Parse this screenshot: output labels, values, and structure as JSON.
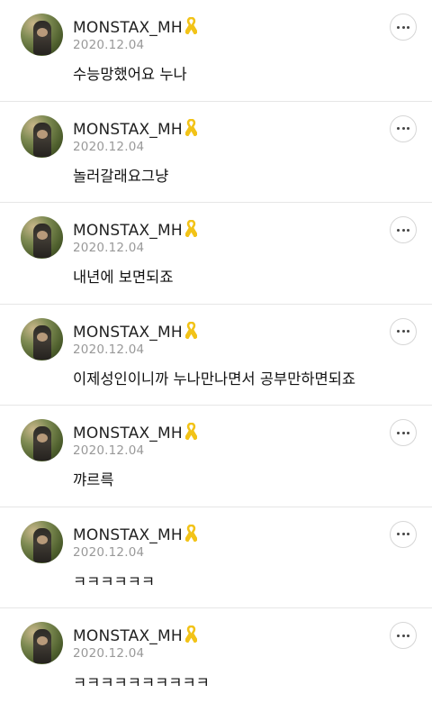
{
  "comments": [
    {
      "username": "MONSTAX_MH",
      "date": "2020.12.04",
      "text": "수능망했어요 누나"
    },
    {
      "username": "MONSTAX_MH",
      "date": "2020.12.04",
      "text": "놀러갈래요그냥"
    },
    {
      "username": "MONSTAX_MH",
      "date": "2020.12.04",
      "text": "내년에 보면되죠"
    },
    {
      "username": "MONSTAX_MH",
      "date": "2020.12.04",
      "text": "이제성인이니까 누나만나면서 공부만하면되죠"
    },
    {
      "username": "MONSTAX_MH",
      "date": "2020.12.04",
      "text": "꺄르륵"
    },
    {
      "username": "MONSTAX_MH",
      "date": "2020.12.04",
      "text": "ㅋㅋㅋㅋㅋㅋ"
    },
    {
      "username": "MONSTAX_MH",
      "date": "2020.12.04",
      "text": "ㅋㅋㅋㅋㅋㅋㅋㅋㅋㅋ"
    }
  ],
  "icons": {
    "badge": "yellow-ribbon-icon",
    "more": "more-dots-icon"
  },
  "colors": {
    "ribbon": "#f2c318",
    "date": "#999999",
    "divider": "#e6e6e6"
  }
}
